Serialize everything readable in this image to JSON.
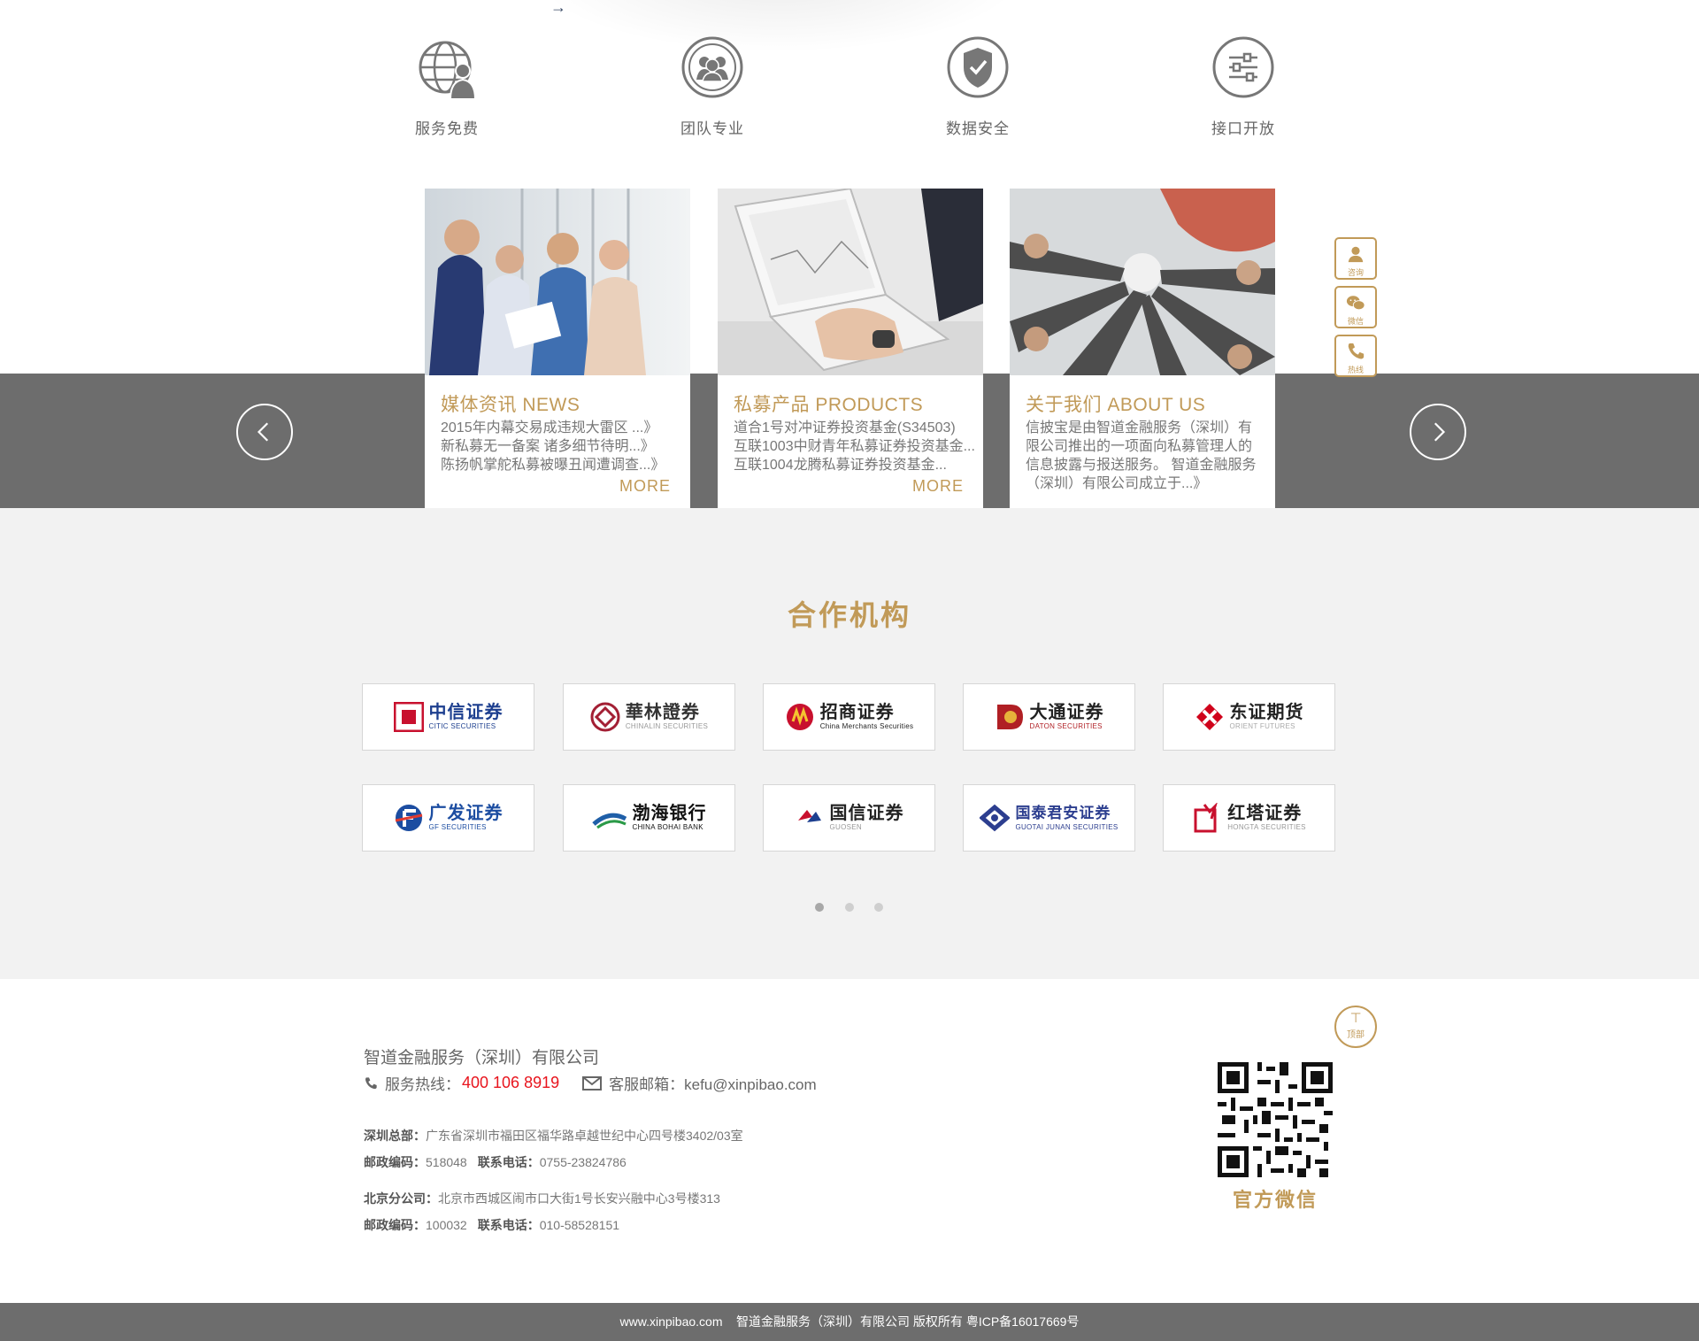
{
  "features": [
    {
      "label": "服务免费",
      "icon": "globe-user-icon"
    },
    {
      "label": "团队专业",
      "icon": "team-icon"
    },
    {
      "label": "数据安全",
      "icon": "shield-check-icon"
    },
    {
      "label": "接口开放",
      "icon": "sliders-icon"
    }
  ],
  "cards": [
    {
      "title": "媒体资讯 NEWS",
      "lines": [
        "2015年内幕交易成违规大雷区 ...》",
        "新私募无一备案 诸多细节待明...》",
        "陈扬帆掌舵私募被曝丑闻遭调查...》"
      ],
      "more": "MORE"
    },
    {
      "title": "私募产品 PRODUCTS",
      "lines": [
        "道合1号对冲证券投资基金(S34503)",
        "互联1003中财青年私募证券投资基金...",
        "互联1004龙腾私募证券投资基金..."
      ],
      "more": "MORE"
    },
    {
      "title": "关于我们 ABOUT US",
      "lines": [
        "信披宝是由智道金融服务（深圳）有",
        "限公司推出的一项面向私募管理人的",
        "信息披露与报送服务。 智道金融服务",
        "（深圳）有限公司成立于...》"
      ],
      "more": ""
    }
  ],
  "side_float": [
    {
      "label": "咨询",
      "icon": "user-headset-icon"
    },
    {
      "label": "微信",
      "icon": "wechat-icon"
    },
    {
      "label": "热线",
      "icon": "phone-icon"
    }
  ],
  "partners": {
    "title": "合作机构",
    "logos": [
      {
        "cn": "中信证券",
        "en": "CITIC SECURITIES",
        "color": "#1d3f8f",
        "mark_color": "#c8102e"
      },
      {
        "cn": "華林證券",
        "en": "CHINALIN SECURITIES",
        "color": "#333333",
        "mark_color": "#a31f34"
      },
      {
        "cn": "招商证券",
        "en": "China Merchants Securities",
        "color": "#222222",
        "mark_color": "#c8102e"
      },
      {
        "cn": "大通证券",
        "en": "DATON SECURITIES",
        "color": "#222222",
        "mark_color": "#b01f24"
      },
      {
        "cn": "东证期货",
        "en": "ORIENT FUTURES",
        "color": "#222222",
        "mark_color": "#d0021b"
      },
      {
        "cn": "广发证券",
        "en": "GF SECURITIES",
        "color": "#1c4da1",
        "mark_color": "#e03a2f"
      },
      {
        "cn": "渤海银行",
        "en": "CHINA BOHAI BANK",
        "color": "#111111",
        "mark_color": "#1f5fa8"
      },
      {
        "cn": "国信证券",
        "en": "GUOSEN",
        "color": "#222222",
        "mark_color": "#c8102e"
      },
      {
        "cn": "国泰君安证券",
        "en": "GUOTAI JUNAN SECURITIES",
        "color": "#2c3e8f",
        "mark_color": "#2c3e8f"
      },
      {
        "cn": "红塔证券",
        "en": "HONGTA SECURITIES",
        "color": "#222222",
        "mark_color": "#c8102e"
      }
    ]
  },
  "footer": {
    "to_top": "顶部",
    "company": "智道金融服务（深圳）有限公司",
    "hotline_label": "服务热线：",
    "hotline": "400 106 8919",
    "email_label": "客服邮箱：kefu@xinpibao.com",
    "sz_hq_label": "深圳总部：",
    "sz_hq": "广东省深圳市福田区福华路卓越世纪中心四号楼3402/03室",
    "sz_zip_label": "邮政编码：",
    "sz_zip": "518048",
    "sz_tel_label": "联系电话：",
    "sz_tel": "0755-23824786",
    "bj_label": "北京分公司：",
    "bj": "北京市西城区闹市口大街1号长安兴融中心3号楼313",
    "bj_zip_label": "邮政编码：",
    "bj_zip": "100032",
    "bj_tel_label": "联系电话：",
    "bj_tel": "010-58528151",
    "qr_label": "官方微信",
    "copyright": "www.xinpibao.com    智道金融服务（深圳）有限公司 版权所有 粤ICP备16017669号"
  },
  "colors": {
    "accent": "#c19a58",
    "band": "#6d6d6d",
    "hotline": "#e8141d"
  }
}
